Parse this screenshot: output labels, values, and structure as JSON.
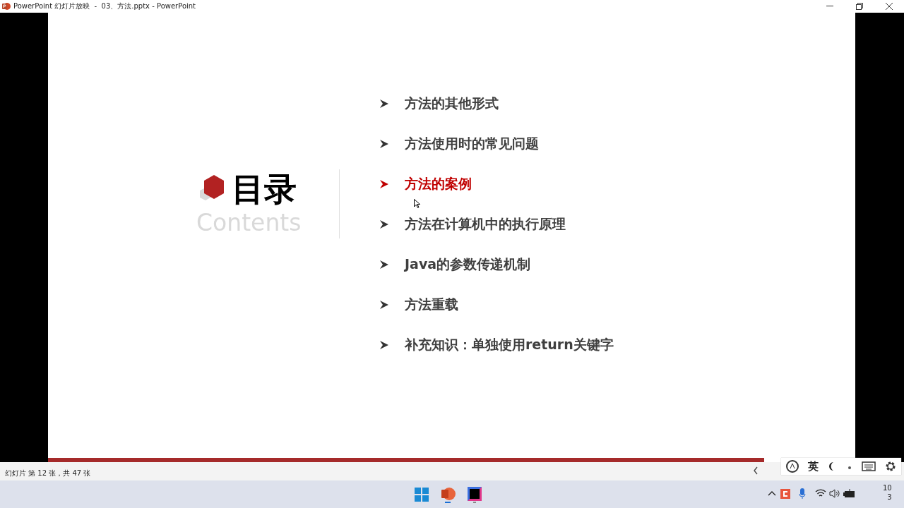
{
  "window": {
    "title": "PowerPoint 幻灯片放映  -  03、方法.pptx - PowerPoint"
  },
  "slide": {
    "heading": "目录",
    "subheading": "Contents",
    "items": [
      {
        "text": "方法的其他形式",
        "selected": false
      },
      {
        "text": "方法使用时的常见问题",
        "selected": false
      },
      {
        "text": "方法的案例",
        "selected": true
      },
      {
        "text": "方法在计算机中的执行原理",
        "selected": false
      },
      {
        "text": "Java的参数传递机制",
        "selected": false
      },
      {
        "text": "方法重载",
        "selected": false
      },
      {
        "text": "补充知识：单独使用return关键字",
        "selected": false
      }
    ]
  },
  "status_bar": {
    "slide_counter": "幻灯片 第 12 张，共 47 张"
  },
  "ime_toolbar": {
    "language": "英"
  },
  "taskbar": {
    "clock": [
      "10",
      "3"
    ]
  }
}
